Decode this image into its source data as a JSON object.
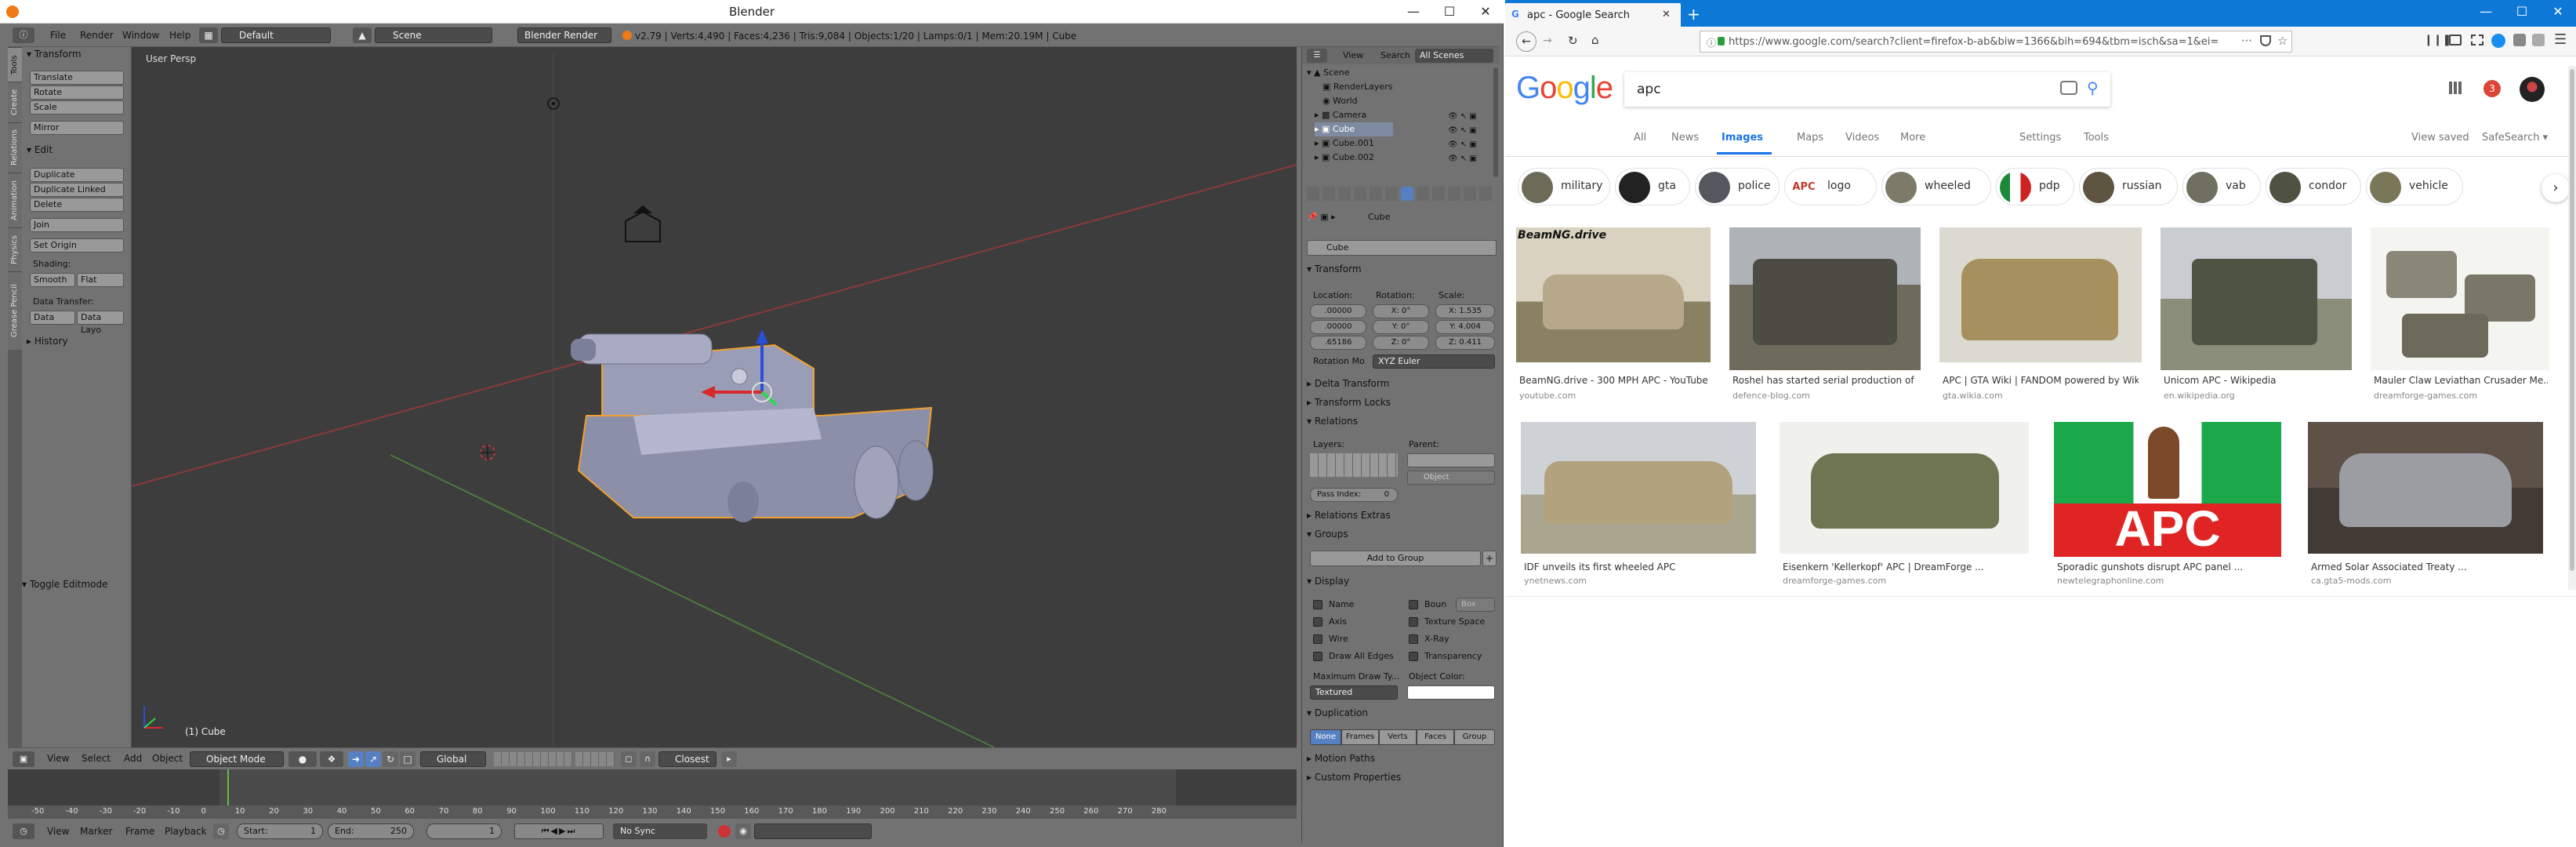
{
  "blender": {
    "window_title": "Blender",
    "menu": [
      "File",
      "Render",
      "Window",
      "Help"
    ],
    "layout": "Default",
    "scene": "Scene",
    "engine": "Blender Render",
    "stats": "v2.79 | Verts:4,490 | Faces:4,236 | Tris:9,084 | Objects:1/20 | Lamps:0/1 | Mem:20.19M | Cube",
    "tool_tabs": [
      "Tools",
      "Create",
      "Relations",
      "Animation",
      "Physics",
      "Grease Pencil"
    ],
    "tools": {
      "transform_header": "Transform",
      "translate": "Translate",
      "rotate": "Rotate",
      "scale": "Scale",
      "mirror": "Mirror",
      "edit_header": "Edit",
      "duplicate": "Duplicate",
      "duplicate_linked": "Duplicate Linked",
      "delete": "Delete",
      "join": "Join",
      "set_origin": "Set Origin",
      "shading_label": "Shading:",
      "smooth": "Smooth",
      "flat": "Flat",
      "data_transfer_label": "Data Transfer:",
      "data": "Data",
      "data_layout": "Data Layo",
      "history_header": "History",
      "toggle_editmode": "Toggle Editmode"
    },
    "viewport": {
      "view_label": "User Persp",
      "object_label": "(1) Cube"
    },
    "viewport_header": {
      "view": "View",
      "select": "Select",
      "add": "Add",
      "object": "Object",
      "mode": "Object Mode",
      "orientation": "Global",
      "snap": "Closest"
    },
    "timeline": {
      "ticks": [
        "-50",
        "-40",
        "-30",
        "-20",
        "-10",
        "0",
        "10",
        "20",
        "30",
        "40",
        "50",
        "60",
        "70",
        "80",
        "90",
        "100",
        "110",
        "120",
        "130",
        "140",
        "150",
        "160",
        "170",
        "180",
        "190",
        "200",
        "210",
        "220",
        "230",
        "240",
        "250",
        "260",
        "270",
        "280"
      ],
      "current_frame": 1,
      "view": "View",
      "marker": "Marker",
      "frame": "Frame",
      "playback": "Playback",
      "start_label": "Start:",
      "start_value": "1",
      "end_label": "End:",
      "end_value": "250",
      "current": "1",
      "sync": "No Sync"
    },
    "outliner": {
      "view": "View",
      "search": "Search",
      "filter": "All Scenes",
      "items": [
        "Scene",
        "RenderLayers",
        "World",
        "Camera",
        "Cube",
        "Cube.001",
        "Cube.002"
      ]
    },
    "properties": {
      "breadcrumb": "Cube",
      "name": "Cube",
      "transform_header": "Transform",
      "location_label": "Location:",
      "rotation_label": "Rotation:",
      "scale_label": "Scale:",
      "loc": [
        ".00000",
        ".00000",
        ".65186"
      ],
      "rot": [
        "X: 0°",
        "Y: 0°",
        "Z: 0°"
      ],
      "scl": [
        "X: 1.535",
        "Y: 4.004",
        "Z: 0.411"
      ],
      "rotation_mode_label": "Rotation Mo",
      "rotation_mode": "XYZ Euler",
      "delta_transform": "Delta Transform",
      "transform_locks": "Transform Locks",
      "relations": "Relations",
      "layers_label": "Layers:",
      "parent_label": "Parent:",
      "parent_type": "Object",
      "pass_index": "Pass Index:",
      "pass_index_value": "0",
      "relations_extras": "Relations Extras",
      "groups": "Groups",
      "add_to_group": "Add to Group",
      "display": "Display",
      "display_left": [
        "Name",
        "Axis",
        "Wire",
        "Draw All Edges"
      ],
      "display_right": [
        "Boun",
        "Texture Space",
        "X-Ray",
        "Transparency"
      ],
      "bounds_type": "Box",
      "max_draw_type_label": "Maximum Draw Ty...",
      "object_color_label": "Object Color:",
      "draw_type": "Textured",
      "duplication": "Duplication",
      "dup_options": [
        "None",
        "Frames",
        "Verts",
        "Faces",
        "Group"
      ],
      "motion_paths": "Motion Paths",
      "custom_properties": "Custom Properties"
    }
  },
  "browser": {
    "tab_title": "apc - Google Search",
    "url": "https://www.google.com/search?client=firefox-b-ab&biw=1366&bih=694&tbm=isch&sa=1&ei=",
    "google": {
      "logo": "Google",
      "query": "apc",
      "notification_count": "3",
      "tabs": [
        "All",
        "News",
        "Images",
        "Maps",
        "Videos",
        "More"
      ],
      "active_tab": "Images",
      "tools": [
        "Settings",
        "Tools"
      ],
      "view_saved": "View saved",
      "safesearch": "SafeSearch ▾",
      "chips": [
        "military",
        "gta",
        "police",
        "logo",
        "wheeled",
        "pdp",
        "russian",
        "vab",
        "condor",
        "vehicle"
      ],
      "chip_logo_text": "APC",
      "results_row1": [
        {
          "caption": "BeamNG.drive - 300 MPH APC - YouTube",
          "source": "youtube.com",
          "overlay": "BeamNG.drive"
        },
        {
          "caption": "Roshel has started serial production of ...",
          "source": "defence-blog.com"
        },
        {
          "caption": "APC | GTA Wiki | FANDOM powered by Wikia",
          "source": "gta.wikia.com"
        },
        {
          "caption": "Unicom APC - Wikipedia",
          "source": "en.wikipedia.org"
        },
        {
          "caption": "Mauler Claw Leviathan Crusader Me...",
          "source": "dreamforge-games.com"
        }
      ],
      "results_row2": [
        {
          "caption": "IDF unveils its first wheeled APC",
          "source": "ynetnews.com"
        },
        {
          "caption": "Eisenkern 'Kellerkopf' APC | DreamForge ...",
          "source": "dreamforge-games.com"
        },
        {
          "caption": "Sporadic gunshots disrupt APC panel ...",
          "source": "newtelegraphonline.com",
          "overlay": "APC"
        },
        {
          "caption": "Armed Solar Associated Treaty ...",
          "source": "ca.gta5-mods.com"
        }
      ]
    }
  }
}
